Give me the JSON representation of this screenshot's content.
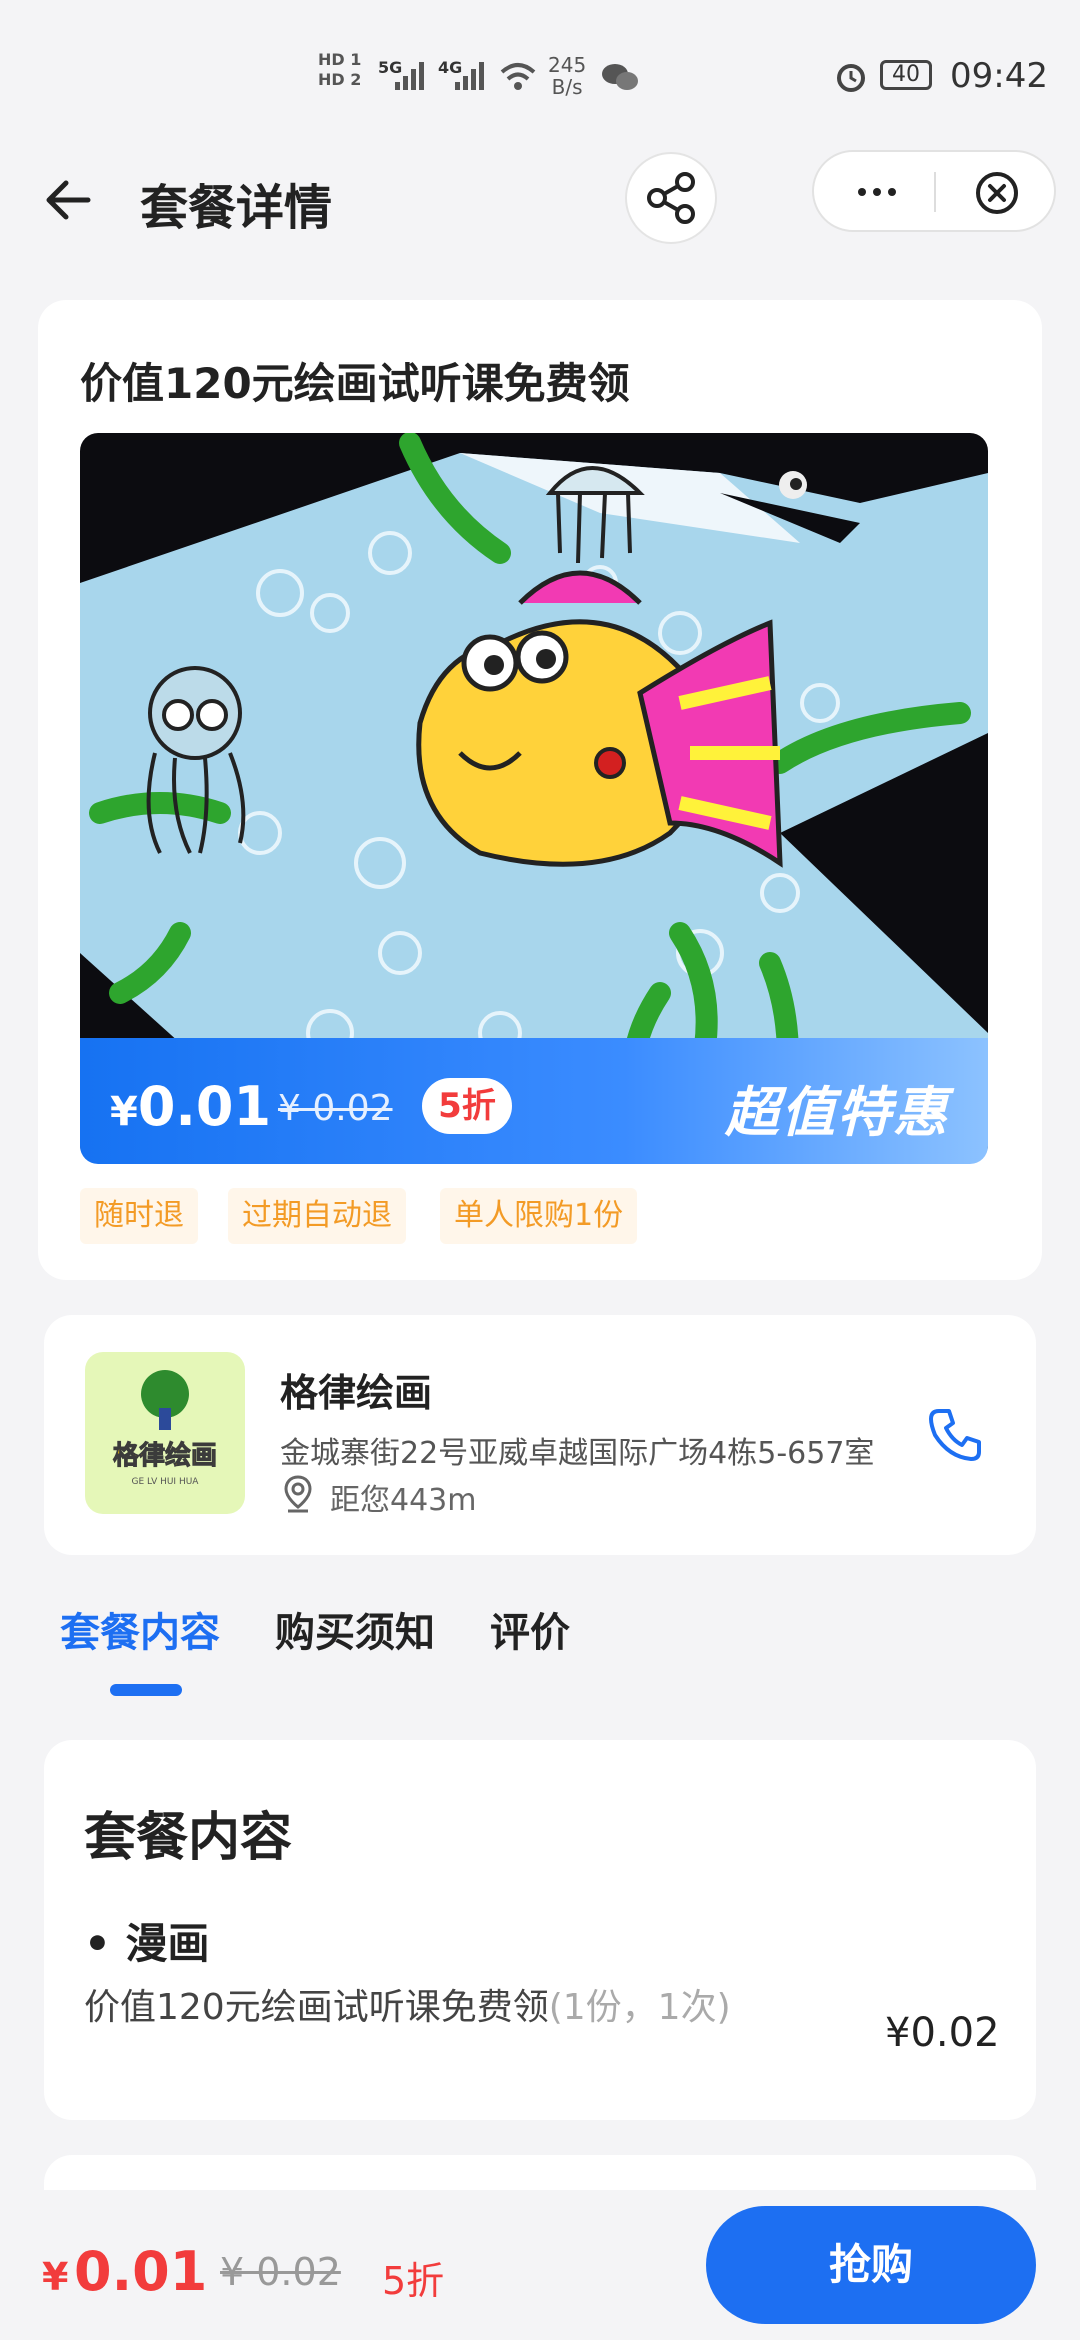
{
  "status_bar": {
    "hd1": "HD 1",
    "hd2": "HD 2",
    "net1": "5G",
    "net2": "4G",
    "speed_value": "245",
    "speed_unit": "B/s",
    "battery": "40",
    "time": "09:42"
  },
  "header": {
    "title": "套餐详情"
  },
  "package": {
    "title": "价值120元绘画试听课免费领",
    "price_currency": "¥",
    "price": "0.01",
    "original_price": "¥ 0.02",
    "discount": "5折",
    "slogan": "超值特惠",
    "tags": [
      "随时退",
      "过期自动退",
      "单人限购1份"
    ]
  },
  "shop": {
    "name": "格律绘画",
    "logo_text": "格律绘画",
    "logo_subtext": "GE LV HUI HUA",
    "address": "金城寨街22号亚威卓越国际广场4栋5-657室",
    "distance": "距您443m"
  },
  "tabs": [
    {
      "label": "套餐内容",
      "active": true
    },
    {
      "label": "购买须知",
      "active": false
    },
    {
      "label": "评价",
      "active": false
    }
  ],
  "content": {
    "section_title": "套餐内容",
    "item_name": "• 漫画",
    "item_desc": "价值120元绘画试听课免费领",
    "item_qty": "(1份，1次)",
    "item_price": "¥0.02"
  },
  "bottom_bar": {
    "price_currency": "¥",
    "price": "0.01",
    "original_price": "¥ 0.02",
    "discount": "5折",
    "buy_label": "抢购"
  },
  "colors": {
    "accent": "#1d6ff2",
    "price_red": "#f23c3c",
    "tag_orange": "#f39b26"
  }
}
